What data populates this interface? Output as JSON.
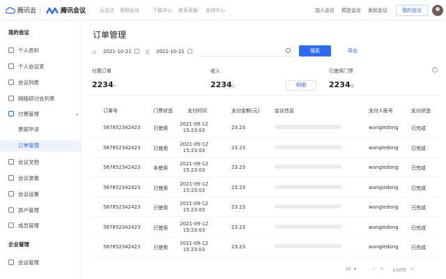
{
  "topbar": {
    "cloud_logo": "腾讯云",
    "meeting_logo": "腾讯会议",
    "nav": [
      "云会议",
      "视频会议",
      "下载中心",
      "联系客服",
      "支持中心"
    ],
    "actions": [
      "加入会议",
      "预定会议",
      "发起会议"
    ],
    "my_meetings": "我的会议"
  },
  "sidebar": {
    "section1": "我的会议",
    "items": [
      {
        "label": "个人资料"
      },
      {
        "label": "个人会议室"
      },
      {
        "label": "会议列表"
      },
      {
        "label": "网络研讨会列表"
      },
      {
        "label": "付费管理"
      }
    ],
    "subitems": [
      {
        "label": "票据申请"
      },
      {
        "label": "订单管理"
      }
    ],
    "items2": [
      {
        "label": "会议文档"
      },
      {
        "label": "会议录像"
      },
      {
        "label": "会议设置"
      },
      {
        "label": "房户管理"
      },
      {
        "label": "成员管理"
      }
    ],
    "section2": "企业管理",
    "items3": [
      {
        "label": "会议管理"
      }
    ]
  },
  "main": {
    "title": "订单管理",
    "filter": {
      "from_label": "从",
      "from_date": "2021-10-21",
      "to_label": "至",
      "to_date": "2021-10-21",
      "search_placeholder": "",
      "search_button": "搜索",
      "export_button": "导出"
    },
    "stats": {
      "paid_orders_label": "付费订单",
      "paid_orders_value": "2234",
      "paid_orders_unit": "个",
      "income_label": "收入",
      "income_value": "2234",
      "income_unit": "元",
      "detail_button": "明细",
      "used_tickets_label": "已使用门票",
      "used_tickets_value": "2234",
      "used_tickets_unit": "张"
    },
    "table": {
      "headers": [
        "订单号",
        "门票状态",
        "支付时间",
        "支付金额(元)",
        "会议信息",
        "支付人账号",
        "支付状态"
      ],
      "rows": [
        {
          "order_no": "567852342423",
          "ticket_status": "已使用",
          "date": "2021-09-12",
          "time": "15:23:03",
          "amount": "23.23",
          "account": "wangledong",
          "pay_status": "已完成"
        },
        {
          "order_no": "567852342423",
          "ticket_status": "已使用",
          "date": "2021-09-12",
          "time": "15:23:03",
          "amount": "23.23",
          "account": "wangledong",
          "pay_status": "已完成"
        },
        {
          "order_no": "567852342423",
          "ticket_status": "未使用",
          "date": "2021-09-12",
          "time": "15:23:03",
          "amount": "23.23",
          "account": "wangledong",
          "pay_status": "已完成"
        },
        {
          "order_no": "567852342423",
          "ticket_status": "已使用",
          "date": "2021-09-12",
          "time": "15:23:03",
          "amount": "23.23",
          "account": "wangledong",
          "pay_status": "已完成"
        },
        {
          "order_no": "567852342423",
          "ticket_status": "已使用",
          "date": "2021-09-12",
          "time": "15:23:03",
          "amount": "23.23",
          "account": "wangledong",
          "pay_status": "已完成"
        },
        {
          "order_no": "567852342423",
          "ticket_status": "已使用",
          "date": "2021-09-12",
          "time": "15:23:03",
          "amount": "23.23",
          "account": "wangledong",
          "pay_status": "已完成"
        },
        {
          "order_no": "567852342423",
          "ticket_status": "已使用",
          "date": "2021-09-12",
          "time": "15:23:03",
          "amount": "23.23",
          "account": "wangledong",
          "pay_status": "已完成"
        }
      ]
    },
    "pager": {
      "page_size": "10",
      "current": "1/10页"
    }
  },
  "colors": {
    "accent": "#2f6bf2",
    "active_bg": "#eef3fe"
  }
}
